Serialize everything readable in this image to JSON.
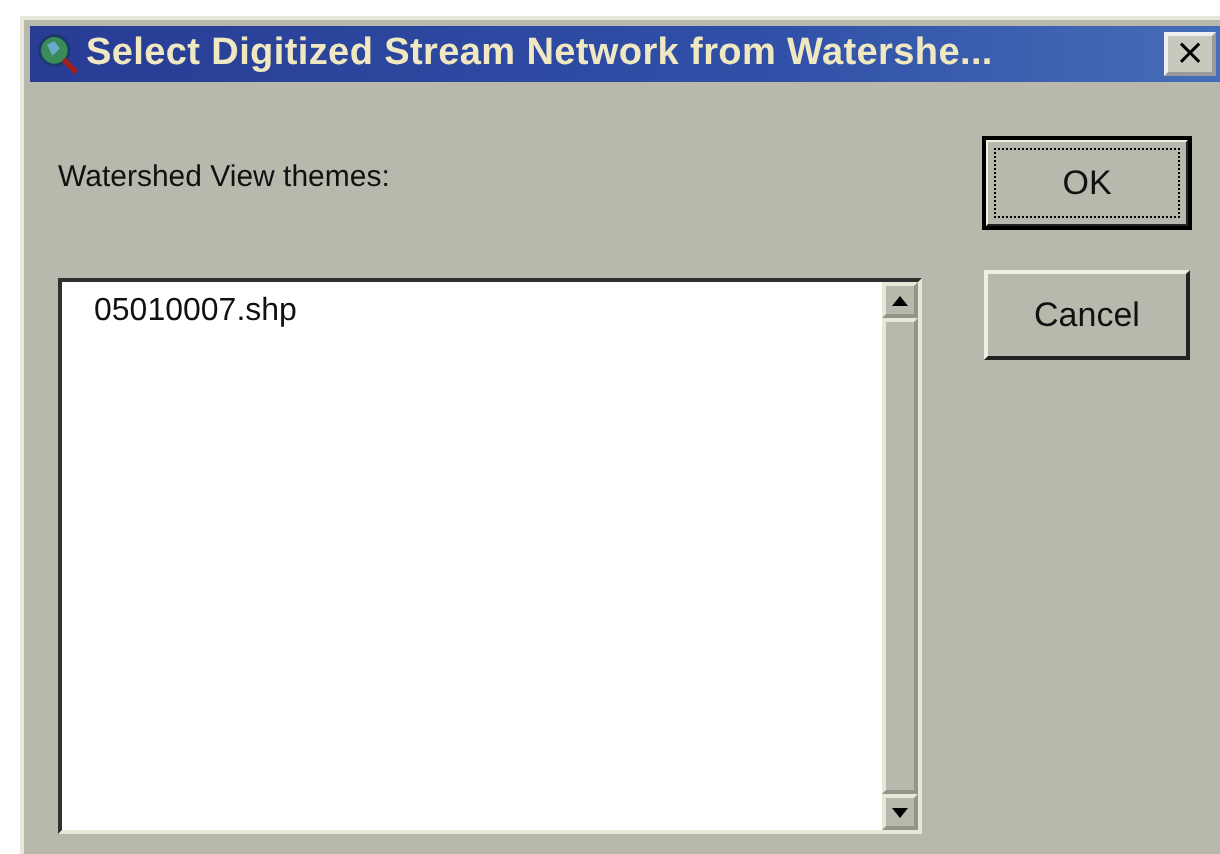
{
  "window": {
    "title": "Select Digitized Stream Network from Watershe...",
    "close": "×"
  },
  "label": "Watershed View themes:",
  "list": {
    "items": [
      {
        "label": "05010007.shp",
        "selected": false
      }
    ]
  },
  "buttons": [
    {
      "label": "OK",
      "default": true
    },
    {
      "label": "Cancel",
      "default": false
    }
  ]
}
